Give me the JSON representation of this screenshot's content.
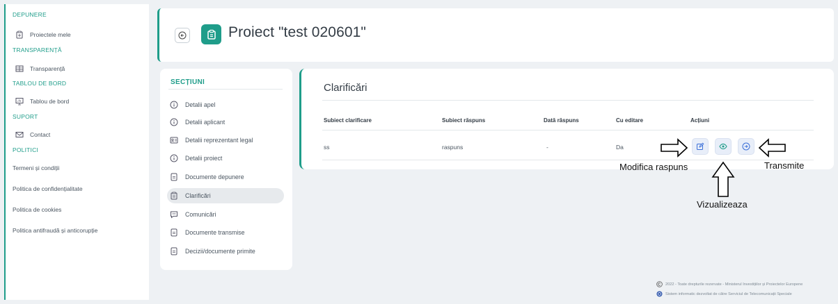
{
  "sidebar": {
    "depunere": {
      "title": "DEPUNERE",
      "items": [
        {
          "label": "Proiectele mele",
          "icon": "clipboard-icon"
        }
      ]
    },
    "transparenta": {
      "title": "TRANSPARENȚĂ",
      "items": [
        {
          "label": "Transparență",
          "icon": "table-icon"
        }
      ]
    },
    "tablou": {
      "title": "TABLOU DE BORD",
      "items": [
        {
          "label": "Tablou de bord",
          "icon": "presentation-icon"
        }
      ]
    },
    "suport": {
      "title": "SUPORT",
      "items": [
        {
          "label": "Contact",
          "icon": "envelope-icon"
        }
      ]
    },
    "politici": {
      "title": "POLITICI",
      "items": [
        {
          "label": "Termeni și condiții"
        },
        {
          "label": "Politica de confidențialitate"
        },
        {
          "label": "Politica de cookies"
        },
        {
          "label": "Politica antifraudă și anticorupție"
        }
      ]
    }
  },
  "header": {
    "title": "Proiect \"test 020601\""
  },
  "sections": {
    "title": "SECȚIUNI",
    "items": [
      {
        "label": "Detalii apel",
        "icon": "info-icon"
      },
      {
        "label": "Detalii aplicant",
        "icon": "info-icon"
      },
      {
        "label": "Detalii reprezentant legal",
        "icon": "id-card-icon"
      },
      {
        "label": "Detalii proiect",
        "icon": "info-icon"
      },
      {
        "label": "Documente depunere",
        "icon": "document-icon"
      },
      {
        "label": "Clarificări",
        "icon": "clipboard-icon",
        "active": true
      },
      {
        "label": "Comunicări",
        "icon": "chat-icon"
      },
      {
        "label": "Documente transmise",
        "icon": "document-icon"
      },
      {
        "label": "Decizii/documente primite",
        "icon": "document-icon"
      }
    ]
  },
  "clarificari": {
    "title": "Clarificări",
    "columns": [
      "Subiect clarificare",
      "Subiect răspuns",
      "Dată răspuns",
      "Cu editare",
      "Acțiuni"
    ],
    "rows": [
      {
        "subiect": "ss",
        "raspuns": "raspuns",
        "data": "-",
        "editare": "Da"
      }
    ]
  },
  "annotations": {
    "modifica": "Modifica raspuns",
    "vizualizeaza": "Vizualizeaza",
    "transmite": "Transmite"
  },
  "footer": {
    "line1": "2022 - Toate drepturile rezervate - Ministerul Investițiilor și Proiectelor Europene",
    "line2": "Sistem informatic dezvoltat de către Serviciul de Telecomunicații Speciale"
  },
  "colors": {
    "accent": "#1f9d8a",
    "action_bg": "#e8eef9",
    "action_icon": "#3b6fd8"
  }
}
